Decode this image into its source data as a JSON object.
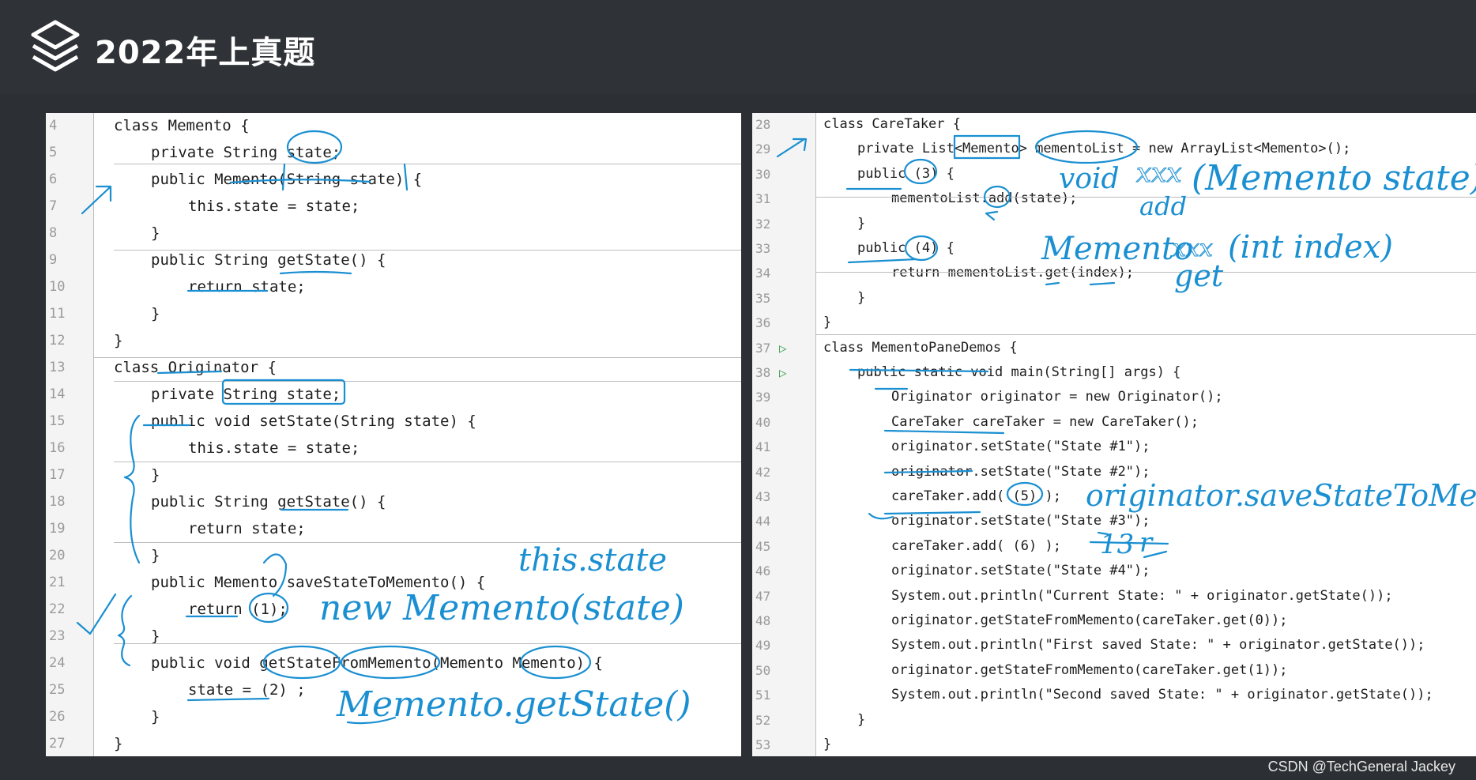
{
  "header": {
    "title": "2022年上真题",
    "logo_icon": "layers-stack-icon"
  },
  "left_code": [
    {
      "n": "4",
      "indent": 0,
      "text": "class Memento {"
    },
    {
      "n": "5",
      "indent": 1,
      "text": "private String state;"
    },
    {
      "n": "6",
      "indent": 1,
      "text": "public Memento(String state) {"
    },
    {
      "n": "7",
      "indent": 2,
      "text": "this.state = state;"
    },
    {
      "n": "8",
      "indent": 1,
      "text": "}"
    },
    {
      "n": "9",
      "indent": 1,
      "text": "public String getState() {"
    },
    {
      "n": "10",
      "indent": 2,
      "text": "return state;"
    },
    {
      "n": "11",
      "indent": 1,
      "text": "}"
    },
    {
      "n": "12",
      "indent": 0,
      "text": "}"
    },
    {
      "n": "13",
      "indent": 0,
      "text": "class Originator {"
    },
    {
      "n": "14",
      "indent": 1,
      "text": "private String state;"
    },
    {
      "n": "15",
      "indent": 1,
      "text": "public void setState(String state) {"
    },
    {
      "n": "16",
      "indent": 2,
      "text": "this.state = state;"
    },
    {
      "n": "17",
      "indent": 1,
      "text": "}"
    },
    {
      "n": "18",
      "indent": 1,
      "text": "public String getState() {"
    },
    {
      "n": "19",
      "indent": 2,
      "text": "return state;"
    },
    {
      "n": "20",
      "indent": 1,
      "text": "}"
    },
    {
      "n": "21",
      "indent": 1,
      "text": "public Memento saveStateToMemento() {"
    },
    {
      "n": "22",
      "indent": 2,
      "text": "return (1);"
    },
    {
      "n": "23",
      "indent": 1,
      "text": "}"
    },
    {
      "n": "24",
      "indent": 1,
      "text": "public void getStateFromMemento(Memento Memento) {"
    },
    {
      "n": "25",
      "indent": 2,
      "text": "state = (2) ;"
    },
    {
      "n": "26",
      "indent": 1,
      "text": "}"
    },
    {
      "n": "27",
      "indent": 0,
      "text": "}"
    }
  ],
  "right_code": [
    {
      "n": "28",
      "indent": 0,
      "text": "class CareTaker {",
      "run": ""
    },
    {
      "n": "29",
      "indent": 1,
      "text": "private List<Memento> mementoList = new ArrayList<Memento>();",
      "run": ""
    },
    {
      "n": "30",
      "indent": 1,
      "text": "public (3) {",
      "run": ""
    },
    {
      "n": "31",
      "indent": 2,
      "text": "mementoList.add(state);",
      "run": ""
    },
    {
      "n": "32",
      "indent": 1,
      "text": "}",
      "run": ""
    },
    {
      "n": "33",
      "indent": 1,
      "text": "public (4) {",
      "run": ""
    },
    {
      "n": "34",
      "indent": 2,
      "text": "return mementoList.get(index);",
      "run": ""
    },
    {
      "n": "35",
      "indent": 1,
      "text": "}",
      "run": ""
    },
    {
      "n": "36",
      "indent": 0,
      "text": "}",
      "run": ""
    },
    {
      "n": "37",
      "indent": 0,
      "text": "class MementoPaneDemos {",
      "run": "▷"
    },
    {
      "n": "38",
      "indent": 1,
      "text": "public static void main(String[] args) {",
      "run": "▷"
    },
    {
      "n": "39",
      "indent": 2,
      "text": "Originator originator = new Originator();",
      "run": ""
    },
    {
      "n": "40",
      "indent": 2,
      "text": "CareTaker careTaker = new CareTaker();",
      "run": ""
    },
    {
      "n": "41",
      "indent": 2,
      "text": "originator.setState(\"State #1\");",
      "run": ""
    },
    {
      "n": "42",
      "indent": 2,
      "text": "originator.setState(\"State #2\");",
      "run": ""
    },
    {
      "n": "43",
      "indent": 2,
      "text": "careTaker.add( (5) );",
      "run": ""
    },
    {
      "n": "44",
      "indent": 2,
      "text": "originator.setState(\"State #3\");",
      "run": ""
    },
    {
      "n": "45",
      "indent": 2,
      "text": "careTaker.add( (6) );",
      "run": ""
    },
    {
      "n": "46",
      "indent": 2,
      "text": "originator.setState(\"State #4\");",
      "run": ""
    },
    {
      "n": "47",
      "indent": 2,
      "text": "System.out.println(\"Current State: \" + originator.getState());",
      "run": ""
    },
    {
      "n": "48",
      "indent": 2,
      "text": "originator.getStateFromMemento(careTaker.get(0));",
      "run": ""
    },
    {
      "n": "49",
      "indent": 2,
      "text": "System.out.println(\"First saved State: \" + originator.getState());",
      "run": ""
    },
    {
      "n": "50",
      "indent": 2,
      "text": "originator.getStateFromMemento(careTaker.get(1));",
      "run": ""
    },
    {
      "n": "51",
      "indent": 2,
      "text": "System.out.println(\"Second saved State: \" + originator.getState());",
      "run": ""
    },
    {
      "n": "52",
      "indent": 1,
      "text": "}",
      "run": ""
    },
    {
      "n": "53",
      "indent": 0,
      "text": "}",
      "run": ""
    }
  ],
  "annotations": {
    "this_state": "this.state",
    "new_memento": "new Memento(state)",
    "memento_getstate": "Memento.getState()",
    "void_label": "void",
    "add_label": "add",
    "memento_state_param": "(Memento state)",
    "memento_type": "Memento",
    "int_index_param": "(int index)",
    "get_label": "get",
    "save_state_call": "originator.saveStateToMemento()",
    "answer_13": "13",
    "answer_r": "r",
    "xxx": "xxx"
  },
  "watermark": "CSDN @TechGeneral Jackey",
  "colors": {
    "background": "#2c2f33",
    "ink": "#1a8fd1",
    "keyword": "#0033b3",
    "field": "#871094",
    "string": "#067d17"
  }
}
